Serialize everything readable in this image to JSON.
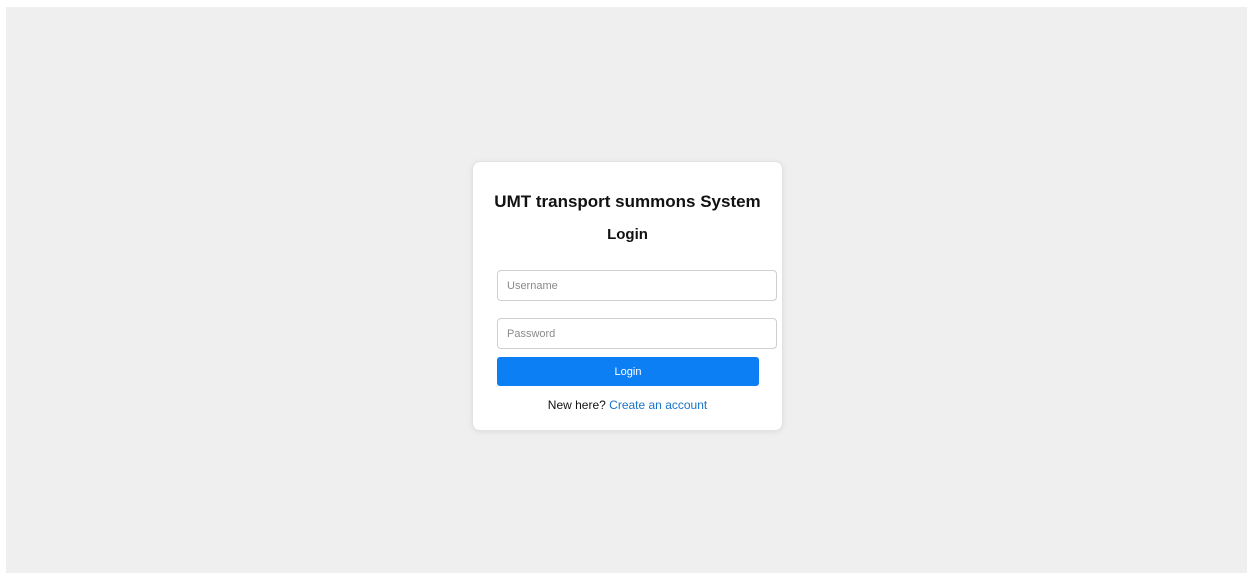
{
  "login": {
    "app_title": "UMT transport summons System",
    "heading": "Login",
    "username_placeholder": "Username",
    "password_placeholder": "Password",
    "login_button": "Login",
    "signup_prompt": "New here?",
    "signup_link": "Create an account"
  },
  "colors": {
    "accent": "#0d7ff5",
    "link": "#1a73c9",
    "background": "#efefef"
  }
}
